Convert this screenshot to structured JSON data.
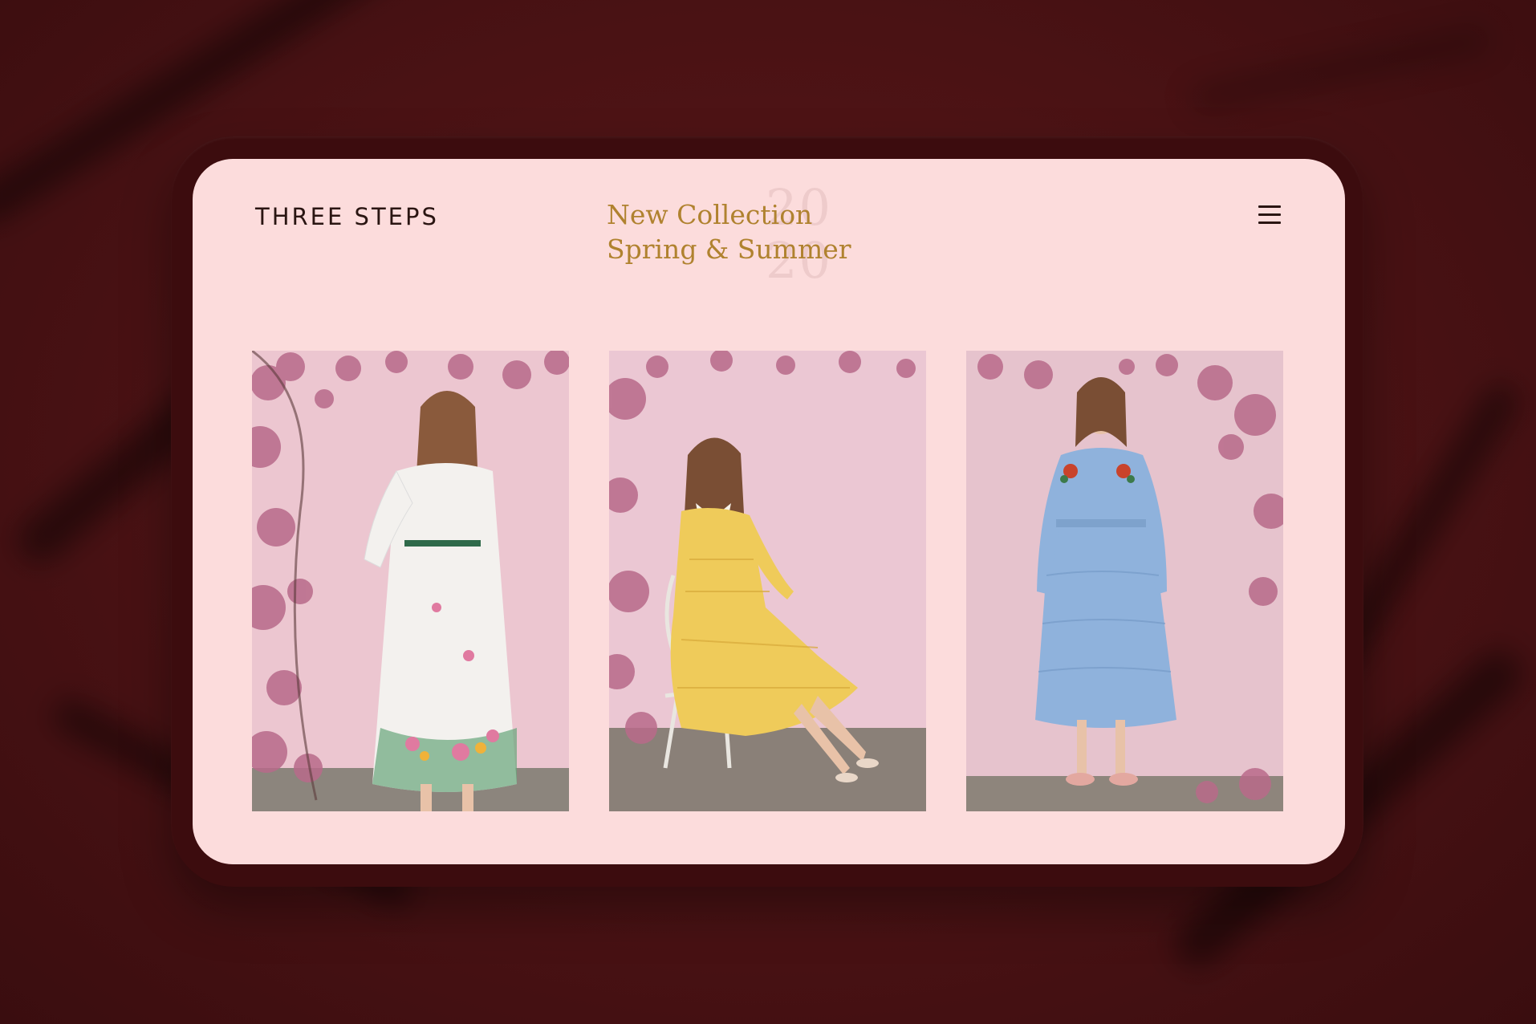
{
  "brand": {
    "logo_text": "THREE STEPS"
  },
  "hero": {
    "line1": "New Collection",
    "line2": "Spring & Summer",
    "year_top": "20",
    "year_bottom": "20"
  },
  "menu": {
    "icon": "hamburger-menu-icon"
  },
  "gallery": {
    "items": [
      {
        "name": "white floral dress",
        "dress_color": "#f3f1ee",
        "accent": "#4a9a6a"
      },
      {
        "name": "yellow lace dress",
        "dress_color": "#efcb5a",
        "accent": "#f6f3ea"
      },
      {
        "name": "blue lace dress",
        "dress_color": "#8fb2dc",
        "accent": "#c9432b"
      }
    ]
  },
  "colors": {
    "background": "#4a1214",
    "screen": "#fcdcdc",
    "headline": "#b0822f",
    "logo": "#2a1512"
  }
}
